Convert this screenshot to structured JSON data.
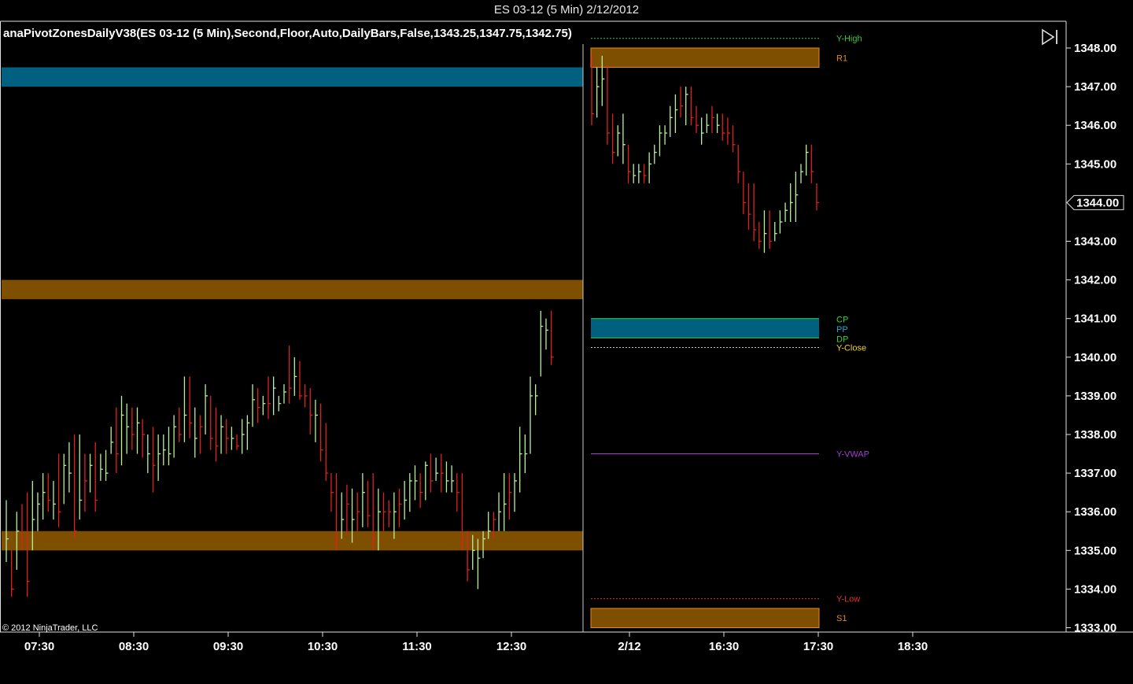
{
  "window": {
    "title": "ES 03-12 (5 Min)  2/12/2012"
  },
  "indicator": {
    "label": "anaPivotZonesDailyV38(ES  03-12  (5  Min),Second,Floor,Auto,DailyBars,False,1343.25,1347.75,1342.75)"
  },
  "copyright": "© 2012 NinjaTrader, LLC",
  "icons": {
    "scroll_end": "scroll-to-end-icon"
  },
  "colors": {
    "background": "#000000",
    "up_bar": "#b8f0a0",
    "down_bar": "#e02020",
    "zone_orange": "#7f4f00",
    "zone_blue": "#00607f",
    "y_high": "#3ec63e",
    "r1": "#e0892a",
    "pivot_text_green": "#40d040",
    "pivot_text_blue": "#2aa7d0",
    "y_close": "#e8d040",
    "y_vwap": "#a040d0",
    "y_low": "#e03030",
    "s1": "#e0892a"
  },
  "chart_data": {
    "type": "ohlc",
    "y_axis": {
      "ticks": [
        "1348.00",
        "1347.00",
        "1346.00",
        "1345.00",
        "1344.00",
        "1343.00",
        "1342.00",
        "1341.00",
        "1340.00",
        "1339.00",
        "1338.00",
        "1337.00",
        "1336.00",
        "1335.00",
        "1334.00",
        "1333.00"
      ],
      "range": [
        1332.8,
        1348.5
      ],
      "last_price": "1344.00"
    },
    "x_axis": {
      "labels": [
        "07:30",
        "08:30",
        "09:30",
        "10:30",
        "11:30",
        "12:30",
        "2/12",
        "16:30",
        "17:30",
        "18:30"
      ],
      "interval_minutes": 5
    },
    "prior_session": {
      "zones": [
        {
          "color": "blue",
          "low": 1347.0,
          "high": 1347.5
        },
        {
          "color": "orange",
          "low": 1341.5,
          "high": 1342.0
        },
        {
          "color": "orange",
          "low": 1335.0,
          "high": 1335.5
        }
      ],
      "bars": [
        [
          1336.3,
          1334.7,
          1335.3,
          "up"
        ],
        [
          1335.0,
          1333.8,
          1334.0,
          "down"
        ],
        [
          1336.0,
          1334.5,
          1335.5,
          "up"
        ],
        [
          1336.2,
          1335.0,
          1335.3,
          "down"
        ],
        [
          1336.5,
          1333.8,
          1334.2,
          "down"
        ],
        [
          1336.8,
          1335.0,
          1335.8,
          "up"
        ],
        [
          1336.5,
          1335.5,
          1336.2,
          "up"
        ],
        [
          1337.0,
          1335.8,
          1336.5,
          "up"
        ],
        [
          1337.0,
          1336.0,
          1336.3,
          "down"
        ],
        [
          1336.8,
          1335.8,
          1336.2,
          "up"
        ],
        [
          1337.5,
          1335.6,
          1336.0,
          "down"
        ],
        [
          1337.5,
          1336.2,
          1337.2,
          "up"
        ],
        [
          1337.8,
          1336.5,
          1337.0,
          "up"
        ],
        [
          1338.0,
          1335.3,
          1335.5,
          "down"
        ],
        [
          1338.0,
          1335.8,
          1336.3,
          "up"
        ],
        [
          1337.5,
          1336.0,
          1336.8,
          "down"
        ],
        [
          1337.5,
          1336.5,
          1337.2,
          "up"
        ],
        [
          1337.8,
          1336.0,
          1336.3,
          "down"
        ],
        [
          1337.5,
          1336.8,
          1337.1,
          "up"
        ],
        [
          1337.6,
          1336.8,
          1337.0,
          "up"
        ],
        [
          1338.2,
          1337.5,
          1337.8,
          "up"
        ],
        [
          1338.7,
          1337.0,
          1337.5,
          "down"
        ],
        [
          1339.0,
          1337.2,
          1338.5,
          "up"
        ],
        [
          1338.8,
          1337.5,
          1338.2,
          "up"
        ],
        [
          1338.7,
          1337.6,
          1338.0,
          "down"
        ],
        [
          1338.7,
          1337.5,
          1338.3,
          "up"
        ],
        [
          1338.4,
          1337.4,
          1338.0,
          "down"
        ],
        [
          1338.0,
          1337.0,
          1337.5,
          "up"
        ],
        [
          1338.2,
          1336.5,
          1337.2,
          "down"
        ],
        [
          1338.0,
          1336.8,
          1337.5,
          "up"
        ],
        [
          1338.0,
          1337.2,
          1337.6,
          "up"
        ],
        [
          1338.2,
          1337.2,
          1337.5,
          "up"
        ],
        [
          1338.5,
          1337.4,
          1338.2,
          "up"
        ],
        [
          1338.7,
          1337.8,
          1338.0,
          "down"
        ],
        [
          1339.5,
          1337.8,
          1338.5,
          "up"
        ],
        [
          1339.5,
          1337.9,
          1338.3,
          "down"
        ],
        [
          1338.7,
          1337.4,
          1337.9,
          "up"
        ],
        [
          1338.5,
          1337.5,
          1338.2,
          "down"
        ],
        [
          1339.3,
          1338.0,
          1339.0,
          "up"
        ],
        [
          1339.0,
          1337.6,
          1337.9,
          "down"
        ],
        [
          1338.7,
          1337.3,
          1337.7,
          "down"
        ],
        [
          1338.5,
          1337.5,
          1338.2,
          "up"
        ],
        [
          1338.4,
          1337.5,
          1337.9,
          "down"
        ],
        [
          1338.2,
          1337.6,
          1337.9,
          "up"
        ],
        [
          1338.0,
          1337.6,
          1337.7,
          "down"
        ],
        [
          1338.4,
          1337.5,
          1338.0,
          "up"
        ],
        [
          1338.5,
          1337.6,
          1338.3,
          "up"
        ],
        [
          1339.3,
          1338.2,
          1338.9,
          "up"
        ],
        [
          1339.2,
          1338.3,
          1338.7,
          "down"
        ],
        [
          1339.0,
          1338.5,
          1338.8,
          "up"
        ],
        [
          1339.5,
          1338.4,
          1338.8,
          "down"
        ],
        [
          1339.5,
          1338.5,
          1339.2,
          "up"
        ],
        [
          1339.0,
          1338.6,
          1338.8,
          "up"
        ],
        [
          1339.3,
          1338.8,
          1339.1,
          "up"
        ],
        [
          1340.3,
          1338.8,
          1339.2,
          "down"
        ],
        [
          1340.0,
          1339.0,
          1339.5,
          "up"
        ],
        [
          1339.9,
          1338.9,
          1339.0,
          "down"
        ],
        [
          1339.3,
          1338.7,
          1339.0,
          "down"
        ],
        [
          1339.2,
          1338.0,
          1338.5,
          "down"
        ],
        [
          1338.9,
          1337.8,
          1338.5,
          "up"
        ],
        [
          1338.8,
          1337.3,
          1337.6,
          "down"
        ],
        [
          1338.3,
          1336.8,
          1337.0,
          "down"
        ],
        [
          1337.0,
          1336.0,
          1336.5,
          "down"
        ],
        [
          1337.0,
          1335.0,
          1335.3,
          "down"
        ],
        [
          1336.5,
          1335.3,
          1335.8,
          "up"
        ],
        [
          1336.7,
          1335.4,
          1336.2,
          "down"
        ],
        [
          1336.6,
          1335.2,
          1335.8,
          "up"
        ],
        [
          1336.5,
          1335.5,
          1336.0,
          "down"
        ],
        [
          1337.0,
          1335.6,
          1336.5,
          "up"
        ],
        [
          1336.8,
          1335.6,
          1335.9,
          "down"
        ],
        [
          1337.0,
          1335.0,
          1335.3,
          "down"
        ],
        [
          1336.6,
          1335.0,
          1336.0,
          "up"
        ],
        [
          1336.5,
          1335.5,
          1336.0,
          "down"
        ],
        [
          1336.3,
          1335.6,
          1336.0,
          "down"
        ],
        [
          1336.5,
          1335.3,
          1336.0,
          "up"
        ],
        [
          1336.6,
          1335.6,
          1336.2,
          "down"
        ],
        [
          1336.8,
          1335.8,
          1336.3,
          "up"
        ],
        [
          1337.0,
          1336.0,
          1336.8,
          "up"
        ],
        [
          1337.2,
          1336.3,
          1336.8,
          "up"
        ],
        [
          1337.0,
          1336.1,
          1336.5,
          "down"
        ],
        [
          1337.3,
          1336.3,
          1337.2,
          "up"
        ],
        [
          1337.5,
          1336.5,
          1336.8,
          "down"
        ],
        [
          1337.4,
          1336.8,
          1337.0,
          "up"
        ],
        [
          1337.5,
          1336.5,
          1337.0,
          "down"
        ],
        [
          1337.3,
          1336.5,
          1336.8,
          "up"
        ],
        [
          1337.2,
          1336.5,
          1336.8,
          "up"
        ],
        [
          1337.0,
          1336.0,
          1336.5,
          "down"
        ],
        [
          1337.0,
          1335.0,
          1335.3,
          "down"
        ],
        [
          1335.5,
          1334.2,
          1334.5,
          "down"
        ],
        [
          1335.4,
          1334.5,
          1335.0,
          "up"
        ],
        [
          1335.3,
          1334.0,
          1334.8,
          "up"
        ],
        [
          1335.5,
          1334.8,
          1335.3,
          "up"
        ],
        [
          1336.0,
          1335.3,
          1335.5,
          "up"
        ],
        [
          1336.0,
          1335.3,
          1335.8,
          "down"
        ],
        [
          1336.5,
          1335.5,
          1336.0,
          "up"
        ],
        [
          1337.0,
          1335.5,
          1336.2,
          "up"
        ],
        [
          1337.0,
          1335.8,
          1336.5,
          "down"
        ],
        [
          1337.0,
          1336.0,
          1336.8,
          "up"
        ],
        [
          1338.2,
          1336.5,
          1337.5,
          "up"
        ],
        [
          1338.0,
          1337.0,
          1337.5,
          "up"
        ],
        [
          1339.5,
          1337.5,
          1339.0,
          "up"
        ],
        [
          1339.3,
          1338.5,
          1339.0,
          "up"
        ],
        [
          1341.2,
          1339.5,
          1340.8,
          "up"
        ],
        [
          1341.0,
          1340.2,
          1340.7,
          "up"
        ],
        [
          1341.2,
          1339.8,
          1340.0,
          "down"
        ]
      ]
    },
    "current_session": {
      "levels": [
        {
          "name": "Y-High",
          "value": 1348.25,
          "style": "dashed"
        },
        {
          "name": "R1",
          "value": 1347.75,
          "style": "zone",
          "zone_low": 1347.5,
          "zone_high": 1348.0
        },
        {
          "name": "CP",
          "value": 1341.0,
          "style": "zone_top"
        },
        {
          "name": "PP",
          "value": 1340.75,
          "style": "label"
        },
        {
          "name": "DP",
          "value": 1340.5,
          "style": "zone_bottom"
        },
        {
          "name": "Y-Close",
          "value": 1340.25,
          "style": "dashed"
        },
        {
          "name": "Y-VWAP",
          "value": 1337.5,
          "style": "solid"
        },
        {
          "name": "Y-Low",
          "value": 1333.75,
          "style": "dashed"
        },
        {
          "name": "S1",
          "value": 1333.25,
          "style": "zone",
          "zone_low": 1333.0,
          "zone_high": 1333.5
        }
      ],
      "bars": [
        [
          1347.8,
          1346.0,
          1346.3,
          "down"
        ],
        [
          1347.5,
          1346.2,
          1347.0,
          "up"
        ],
        [
          1347.8,
          1346.5,
          1347.2,
          "up"
        ],
        [
          1347.5,
          1345.5,
          1345.8,
          "down"
        ],
        [
          1346.3,
          1345.0,
          1345.3,
          "down"
        ],
        [
          1346.0,
          1345.2,
          1345.8,
          "up"
        ],
        [
          1346.3,
          1345.0,
          1345.5,
          "up"
        ],
        [
          1345.5,
          1344.5,
          1344.8,
          "down"
        ],
        [
          1345.0,
          1344.5,
          1344.7,
          "up"
        ],
        [
          1345.0,
          1344.5,
          1344.8,
          "up"
        ],
        [
          1345.0,
          1344.5,
          1344.7,
          "down"
        ],
        [
          1345.3,
          1344.5,
          1345.0,
          "up"
        ],
        [
          1345.5,
          1345.0,
          1345.3,
          "up"
        ],
        [
          1346.0,
          1345.2,
          1345.8,
          "up"
        ],
        [
          1346.0,
          1345.5,
          1345.8,
          "up"
        ],
        [
          1346.5,
          1345.7,
          1346.2,
          "up"
        ],
        [
          1346.8,
          1345.8,
          1346.4,
          "up"
        ],
        [
          1347.0,
          1346.2,
          1346.5,
          "down"
        ],
        [
          1347.0,
          1346.0,
          1346.8,
          "up"
        ],
        [
          1347.0,
          1346.0,
          1346.2,
          "down"
        ],
        [
          1346.5,
          1345.8,
          1346.0,
          "down"
        ],
        [
          1346.2,
          1345.5,
          1345.8,
          "up"
        ],
        [
          1346.3,
          1345.8,
          1346.0,
          "up"
        ],
        [
          1346.5,
          1345.8,
          1346.2,
          "down"
        ],
        [
          1346.3,
          1345.8,
          1346.0,
          "up"
        ],
        [
          1346.3,
          1345.6,
          1345.8,
          "down"
        ],
        [
          1346.2,
          1345.5,
          1345.8,
          "down"
        ],
        [
          1346.0,
          1345.3,
          1345.5,
          "down"
        ],
        [
          1345.5,
          1344.5,
          1344.8,
          "down"
        ],
        [
          1344.8,
          1343.7,
          1344.0,
          "down"
        ],
        [
          1344.5,
          1343.3,
          1343.7,
          "down"
        ],
        [
          1344.5,
          1343.0,
          1343.3,
          "down"
        ],
        [
          1343.5,
          1342.8,
          1343.0,
          "down"
        ],
        [
          1343.8,
          1342.7,
          1343.2,
          "up"
        ],
        [
          1343.8,
          1342.8,
          1343.0,
          "down"
        ],
        [
          1343.5,
          1343.0,
          1343.2,
          "up"
        ],
        [
          1343.8,
          1343.2,
          1343.5,
          "up"
        ],
        [
          1344.0,
          1343.5,
          1343.8,
          "up"
        ],
        [
          1344.5,
          1343.5,
          1344.0,
          "up"
        ],
        [
          1344.8,
          1343.5,
          1344.2,
          "up"
        ],
        [
          1345.0,
          1344.5,
          1344.8,
          "up"
        ],
        [
          1345.5,
          1344.7,
          1345.3,
          "up"
        ],
        [
          1345.5,
          1344.5,
          1344.8,
          "down"
        ],
        [
          1344.5,
          1343.8,
          1344.0,
          "down"
        ]
      ]
    }
  }
}
